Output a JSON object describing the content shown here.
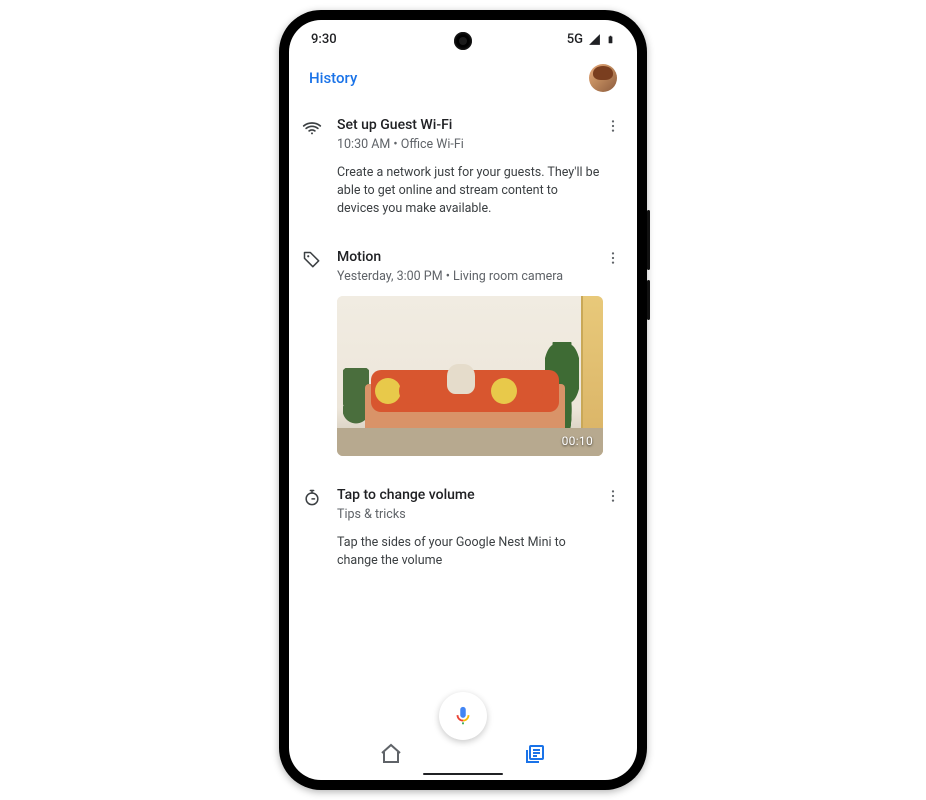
{
  "status": {
    "time": "9:30",
    "network": "5G"
  },
  "header": {
    "title": "History"
  },
  "feed": [
    {
      "icon": "wifi-icon",
      "title": "Set up Guest Wi-Fi",
      "subtitle": "10:30 AM • Office Wi-Fi",
      "description": "Create a network just for your guests. They'll be able to get online and stream content to devices you make available."
    },
    {
      "icon": "tag-icon",
      "title": "Motion",
      "subtitle": "Yesterday, 3:00 PM • Living room camera",
      "thumbnail_duration": "00:10"
    },
    {
      "icon": "stopwatch-icon",
      "title": "Tap to change volume",
      "subtitle": "Tips & tricks",
      "description": "Tap the sides of your Google Nest Mini to change the volume"
    }
  ],
  "nav": {
    "home_active": false,
    "activity_active": true
  }
}
